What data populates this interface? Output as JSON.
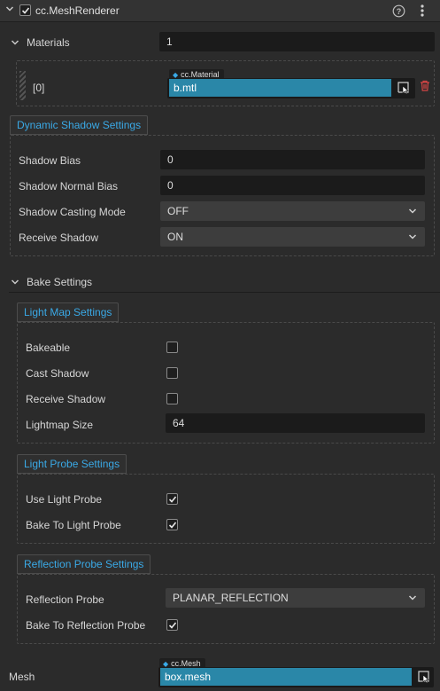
{
  "component": {
    "title": "cc.MeshRenderer",
    "enabled": true
  },
  "materials": {
    "label": "Materials",
    "count": "1",
    "items": [
      {
        "index_label": "[0]",
        "asset_type": "cc.Material",
        "value": "b.mtl"
      }
    ]
  },
  "dynamic_shadow": {
    "tab": "Dynamic Shadow Settings",
    "shadow_bias_label": "Shadow Bias",
    "shadow_bias_value": "0",
    "shadow_normal_bias_label": "Shadow Normal Bias",
    "shadow_normal_bias_value": "0",
    "casting_mode_label": "Shadow Casting Mode",
    "casting_mode_value": "OFF",
    "receive_shadow_label": "Receive Shadow",
    "receive_shadow_value": "ON"
  },
  "bake": {
    "label": "Bake Settings",
    "light_map": {
      "tab": "Light Map Settings",
      "bakeable_label": "Bakeable",
      "bakeable": false,
      "cast_shadow_label": "Cast Shadow",
      "cast_shadow": false,
      "receive_shadow_label": "Receive Shadow",
      "receive_shadow": false,
      "lightmap_size_label": "Lightmap Size",
      "lightmap_size_value": "64"
    },
    "light_probe": {
      "tab": "Light Probe Settings",
      "use_label": "Use Light Probe",
      "use": true,
      "bake_to_label": "Bake To Light Probe",
      "bake_to": true
    },
    "reflection_probe": {
      "tab": "Reflection Probe Settings",
      "probe_label": "Reflection Probe",
      "probe_value": "PLANAR_REFLECTION",
      "bake_to_label": "Bake To Reflection Probe",
      "bake_to": true
    }
  },
  "mesh": {
    "label": "Mesh",
    "asset_type": "cc.Mesh",
    "value": "box.mesh"
  },
  "colors": {
    "accent": "#3aa9e6",
    "asset_field": "#2a87a8",
    "delete": "#d64545",
    "background": "#2b2b2b"
  }
}
